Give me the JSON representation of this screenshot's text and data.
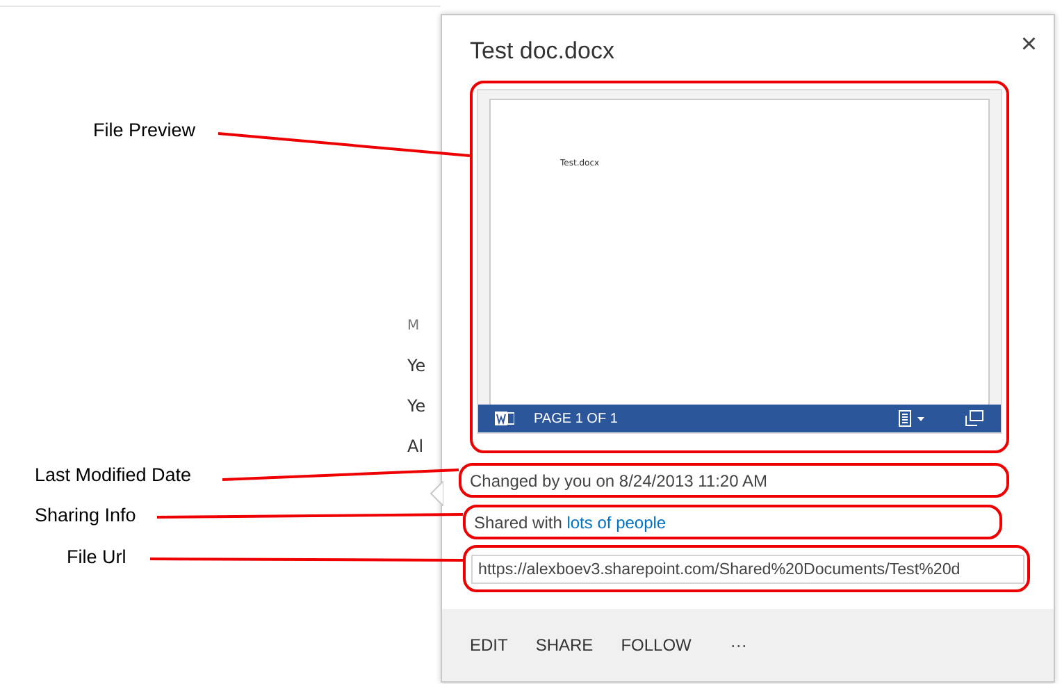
{
  "background_list": {
    "header": "M",
    "items": [
      "Ye",
      "Ye",
      "Al"
    ]
  },
  "callout": {
    "title": "Test doc.docx",
    "close": "×",
    "preview": {
      "document_text": "Test.docx",
      "status": "PAGE 1 OF 1"
    },
    "modified": "Changed by you on 8/24/2013 11:20 AM",
    "sharing": {
      "prefix": "Shared with",
      "link": "lots of people"
    },
    "url": "https://alexboev3.sharepoint.com/Shared%20Documents/Test%20d",
    "actions": [
      "EDIT",
      "SHARE",
      "FOLLOW",
      "···"
    ]
  },
  "annotations": [
    {
      "label": "File Preview"
    },
    {
      "label": "Last Modified Date"
    },
    {
      "label": "Sharing Info"
    },
    {
      "label": "File Url"
    }
  ]
}
